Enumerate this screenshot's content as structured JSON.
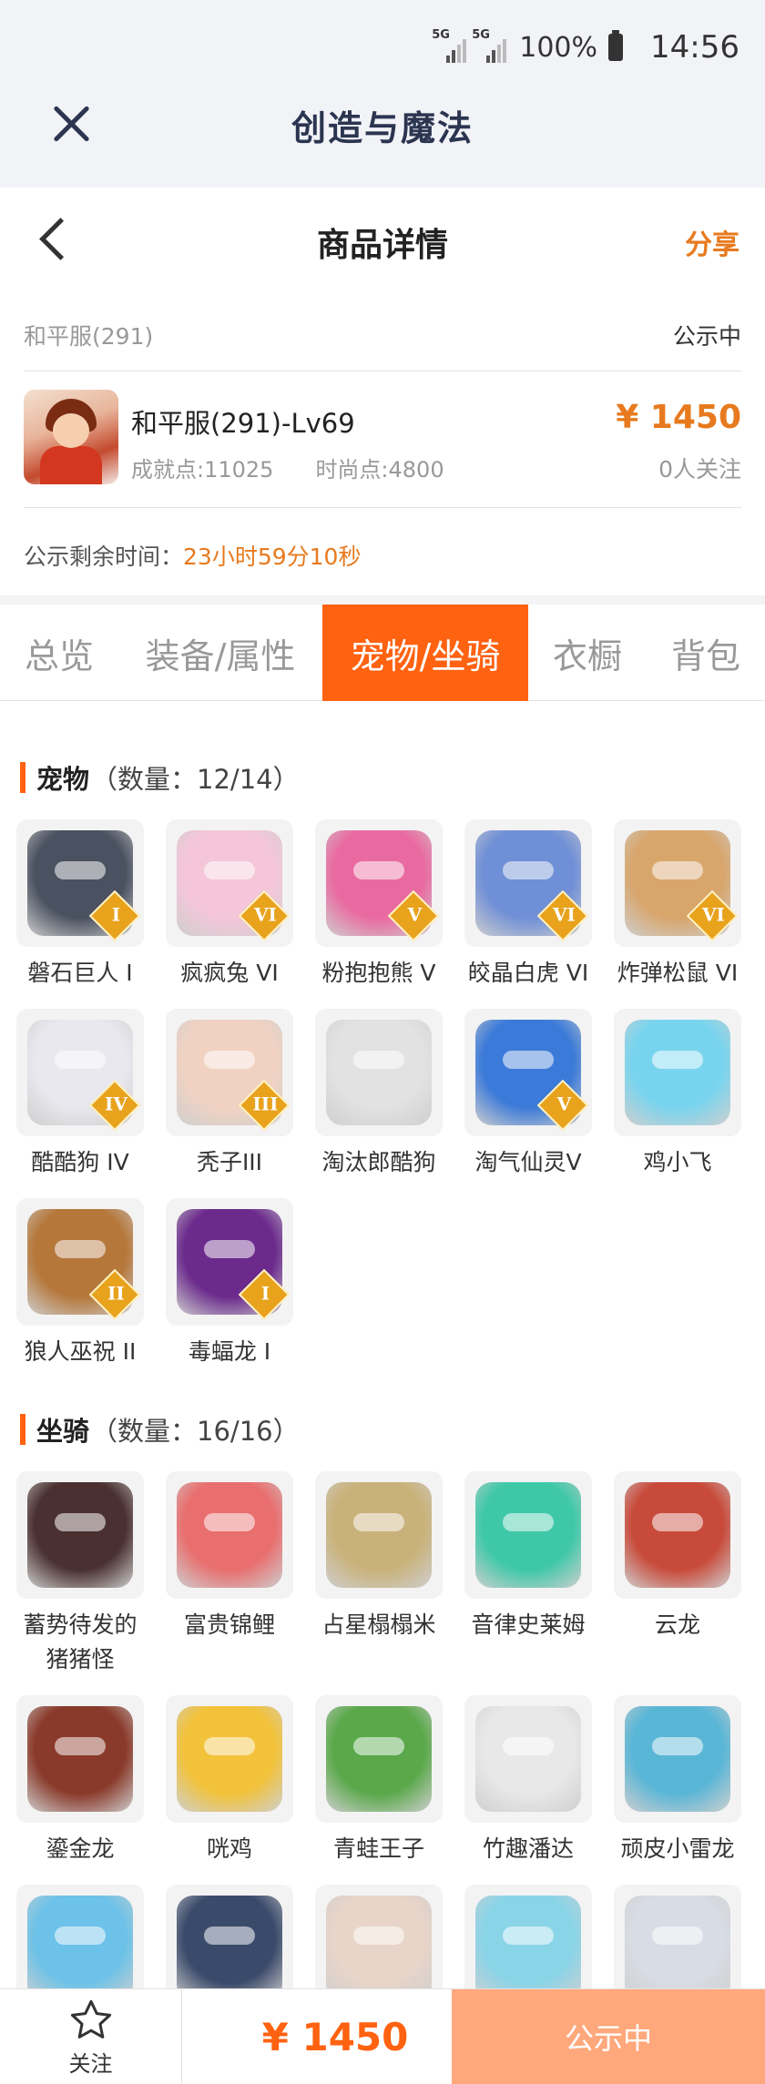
{
  "status_bar": {
    "net1": "5G",
    "net2": "5G",
    "battery": "100%",
    "time": "14:56"
  },
  "app_bar": {
    "title": "创造与魔法"
  },
  "page_header": {
    "title": "商品详情",
    "share": "分享"
  },
  "item": {
    "server": "和平服(291)",
    "status": "公示中",
    "name": "和平服(291)-Lv69",
    "achievement": "成就点:11025",
    "fashion": "时尚点:4800",
    "price": "¥ 1450",
    "followers": "0人关注",
    "time_label": "公示剩余时间：",
    "time_value": "23小时59分10秒"
  },
  "tabs": [
    {
      "label": "总览",
      "active": false
    },
    {
      "label": "装备/属性",
      "active": false
    },
    {
      "label": "宠物/坐骑",
      "active": true
    },
    {
      "label": "衣橱",
      "active": false
    },
    {
      "label": "背包",
      "active": false
    }
  ],
  "pets": {
    "title": "宠物",
    "count": "（数量：12/14）",
    "items": [
      {
        "name": "磐石巨人 I",
        "rank": "I",
        "color": "#4a5160"
      },
      {
        "name": "疯疯兔 VI",
        "rank": "VI",
        "color": "#f4c6d8"
      },
      {
        "name": "粉抱抱熊 V",
        "rank": "V",
        "color": "#e96aa0"
      },
      {
        "name": "皎晶白虎 VI",
        "rank": "VI",
        "color": "#6f8fd6"
      },
      {
        "name": "炸弹松鼠 VI",
        "rank": "VI",
        "color": "#d8a56b"
      },
      {
        "name": "酷酷狗 IV",
        "rank": "IV",
        "color": "#e8e8ee"
      },
      {
        "name": "秃子III",
        "rank": "III",
        "color": "#f1d2c2"
      },
      {
        "name": "淘汰郎酷狗",
        "rank": "",
        "color": "#e2e2e2"
      },
      {
        "name": "淘气仙灵V",
        "rank": "V",
        "color": "#3b7ad8"
      },
      {
        "name": "鸡小飞",
        "rank": "",
        "color": "#78d4ee"
      },
      {
        "name": "狼人巫祝 II",
        "rank": "II",
        "color": "#b5773a"
      },
      {
        "name": "毒蝠龙 I",
        "rank": "I",
        "color": "#6b2a8c"
      }
    ]
  },
  "mounts": {
    "title": "坐骑",
    "count": "（数量：16/16）",
    "items": [
      {
        "name": "蓄势待发的猪猪怪",
        "color": "#4a3030"
      },
      {
        "name": "富贵锦鲤",
        "color": "#e96e6e"
      },
      {
        "name": "占星榻榻米",
        "color": "#c9b27a"
      },
      {
        "name": "音律史莱姆",
        "color": "#3ec8a8"
      },
      {
        "name": "云龙",
        "color": "#c84a3a"
      },
      {
        "name": "鎏金龙",
        "color": "#8a3a2a"
      },
      {
        "name": "咣鸡",
        "color": "#f2c23a"
      },
      {
        "name": "青蛙王子",
        "color": "#5aa84a"
      },
      {
        "name": "竹趣潘达",
        "color": "#e8e8e8"
      },
      {
        "name": "顽皮小雷龙",
        "color": "#5ab6d6"
      },
      {
        "name": "",
        "color": "#6cc2e8"
      },
      {
        "name": "",
        "color": "#3a4a6a"
      },
      {
        "name": "",
        "color": "#e8d4c8"
      },
      {
        "name": "",
        "color": "#8ad4e8"
      },
      {
        "name": "",
        "color": "#d8dce4"
      }
    ]
  },
  "bottom_bar": {
    "follow": "关注",
    "price": "¥ 1450",
    "status": "公示中"
  },
  "colors": {
    "accent": "#ff6210",
    "price": "#e77a1e",
    "status_button": "#ffa87c"
  }
}
